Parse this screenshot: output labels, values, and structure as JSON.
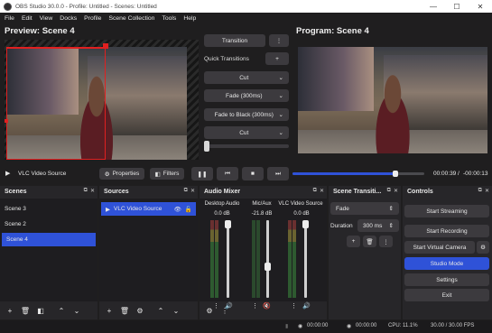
{
  "window": {
    "title": "OBS Studio 30.0.0 - Profile: Untitled - Scenes: Untitled",
    "min_glyph": "—",
    "max_glyph": "☐",
    "close_glyph": "✕"
  },
  "menu": [
    "File",
    "Edit",
    "View",
    "Docks",
    "Profile",
    "Scene Collection",
    "Tools",
    "Help"
  ],
  "preview": {
    "title": "Preview: Scene 4"
  },
  "program": {
    "title": "Program: Scene 4"
  },
  "transitions": {
    "transition_label": "Transition",
    "quick_label": "Quick Transitions",
    "items": [
      "Cut",
      "Fade (300ms)",
      "Fade to Black (300ms)",
      "Cut"
    ]
  },
  "source_bar": {
    "name": "VLC Video Source",
    "properties": "Properties",
    "filters": "Filters",
    "time_current": "00:00:39",
    "time_total": "-00:00:13",
    "progress": 0.78
  },
  "scenes": {
    "title": "Scenes",
    "items": [
      "Scene 3",
      "Scene 2",
      "Scene 4"
    ],
    "active_index": 2
  },
  "sources": {
    "title": "Sources",
    "items": [
      "VLC Video Source"
    ]
  },
  "mixer": {
    "title": "Audio Mixer",
    "channels": [
      {
        "name": "Desktop Audio",
        "db": "0.0 dB",
        "level": 1.0,
        "muted": false
      },
      {
        "name": "Mic/Aux",
        "db": "-21.8 dB",
        "level": 0.45,
        "muted": true
      },
      {
        "name": "VLC Video Source",
        "db": "0.0 dB",
        "level": 1.0,
        "muted": false
      }
    ],
    "scale": [
      "0",
      "-5",
      "-10",
      "-15",
      "-20",
      "-25",
      "-30",
      "-35",
      "-40",
      "-45",
      "-50",
      "-55",
      "-60"
    ]
  },
  "scene_transitions": {
    "title": "Scene Transiti...",
    "selected": "Fade",
    "duration_label": "Duration",
    "duration_value": "300 ms"
  },
  "controls": {
    "title": "Controls",
    "start_streaming": "Start Streaming",
    "start_recording": "Start Recording",
    "start_virtual_camera": "Start Virtual Camera",
    "studio_mode": "Studio Mode",
    "settings": "Settings",
    "exit": "Exit"
  },
  "status": {
    "stream_time": "00:00:00",
    "record_time": "00:00:00",
    "cpu": "CPU: 11.1%",
    "fps": "30.00 / 30.00 FPS"
  },
  "colors": {
    "accent": "#2f52d8",
    "bg": "#1f1e1f",
    "dock": "#272629",
    "muted_red": "#d23a3a"
  }
}
